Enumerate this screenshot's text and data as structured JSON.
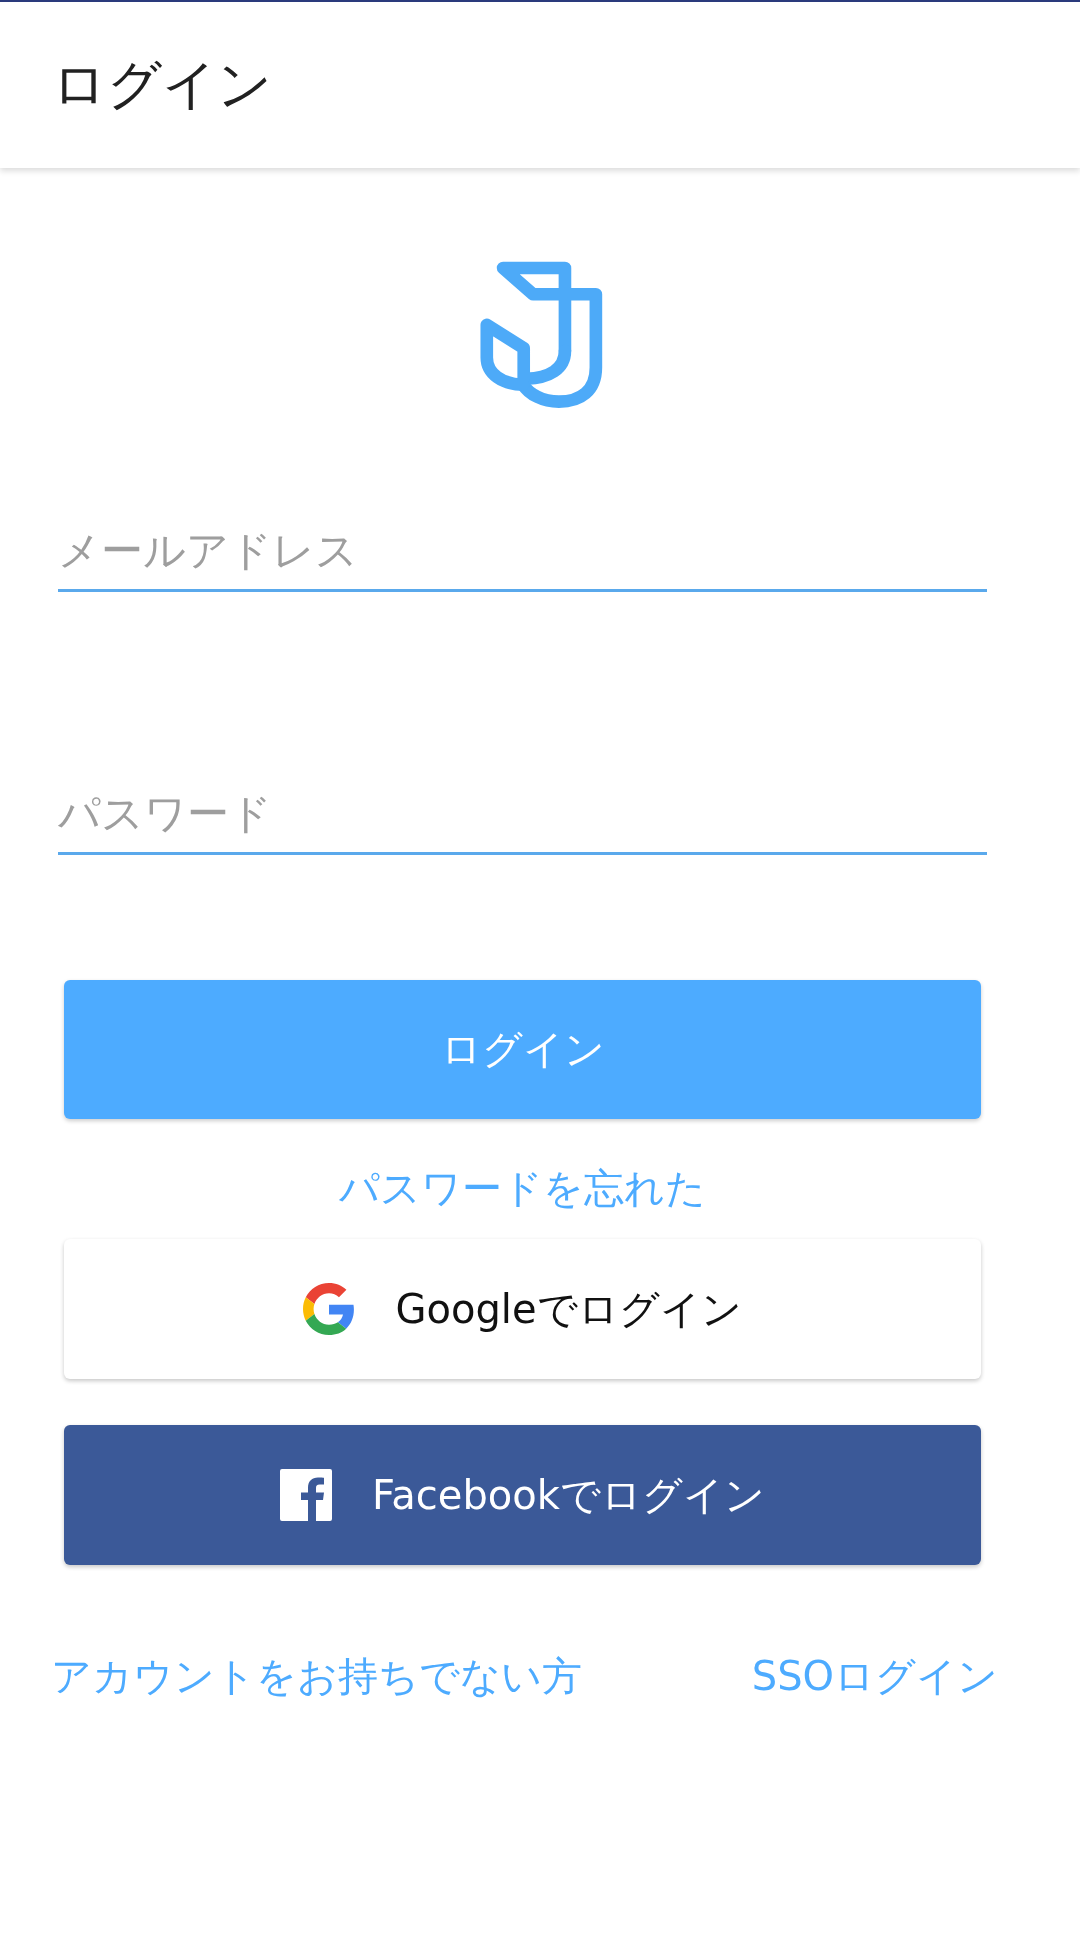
{
  "app_bar": {
    "title": "ログイン"
  },
  "form": {
    "fields": [
      {
        "placeholder": "メールアドレス"
      },
      {
        "placeholder": "パスワード"
      }
    ],
    "login_button": {
      "label": "ログイン"
    },
    "forgot_password_link": "パスワードを忘れた"
  },
  "social_buttons": [
    {
      "kind": "google",
      "label": "Googleでログイン"
    },
    {
      "kind": "facebook",
      "label": "Facebookでログイン"
    }
  ],
  "footer_links": [
    {
      "label": "アカウントをお持ちでない方"
    },
    {
      "label": "SSOログイン"
    }
  ]
}
